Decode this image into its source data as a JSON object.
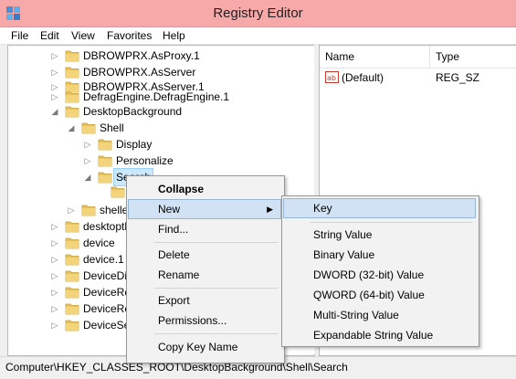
{
  "window": {
    "title": "Registry Editor"
  },
  "menubar": [
    "File",
    "Edit",
    "View",
    "Favorites",
    "Help"
  ],
  "tree": {
    "rows": [
      {
        "label": "DBROWPRX.AsProxy.1"
      },
      {
        "label": "DBROWPRX.AsServer"
      },
      {
        "label": "DBROWPRX.AsServer.1"
      },
      {
        "label": "DefragEngine.DefragEngine.1"
      },
      {
        "label": "DesktopBackground"
      },
      {
        "label": "Shell"
      },
      {
        "label": "Display"
      },
      {
        "label": "Personalize"
      },
      {
        "label": "Search"
      },
      {
        "label": ""
      },
      {
        "label": "shellex"
      },
      {
        "label": "desktopthemepackfile"
      },
      {
        "label": "device"
      },
      {
        "label": "device.1"
      },
      {
        "label": "DeviceDisplayObject"
      },
      {
        "label": "DeviceRect"
      },
      {
        "label": "DeviceRect.1"
      },
      {
        "label": "DeviceSearch"
      }
    ]
  },
  "list": {
    "columns": {
      "name": "Name",
      "type": "Type"
    },
    "rows": [
      {
        "name": "(Default)",
        "type": "REG_SZ"
      }
    ]
  },
  "status": {
    "path": "Computer\\HKEY_CLASSES_ROOT\\DesktopBackground\\Shell\\Search"
  },
  "context_menu": {
    "items": [
      "Collapse",
      "New",
      "Find...",
      "Delete",
      "Rename",
      "Export",
      "Permissions...",
      "Copy Key Name"
    ]
  },
  "new_submenu": {
    "items": [
      "Key",
      "String Value",
      "Binary Value",
      "DWORD (32-bit) Value",
      "QWORD (64-bit) Value",
      "Multi-String Value",
      "Expandable String Value"
    ]
  },
  "glyphs": {
    "collapsed": "▷",
    "expanded": "◢",
    "submenu": "▶"
  },
  "colors": {
    "titlebar": "#f7a8a8",
    "folder": "#e8c15a",
    "selection": "#cce8ff",
    "menu_hover": "#d0e2f4"
  }
}
